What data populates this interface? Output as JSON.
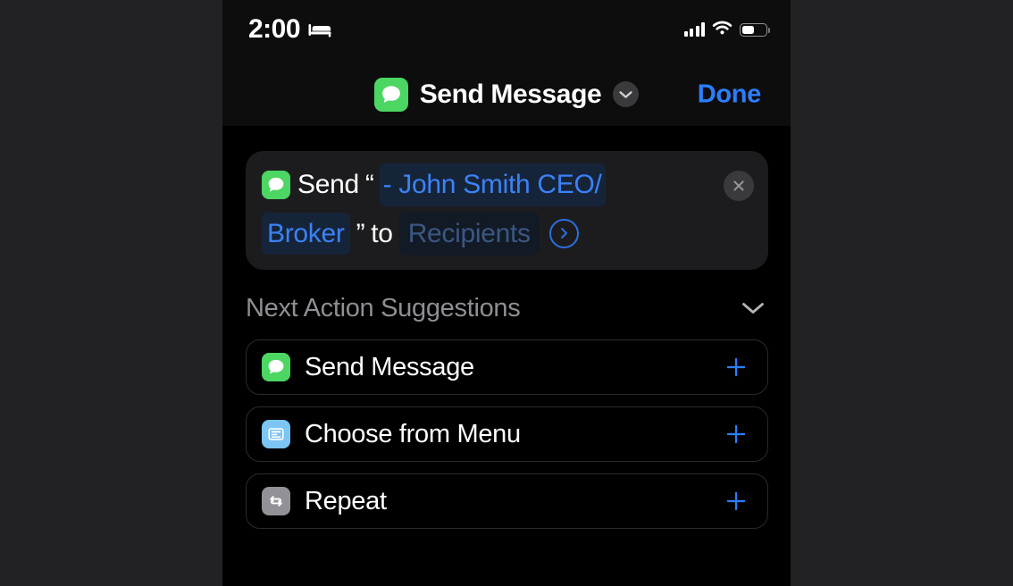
{
  "status_bar": {
    "time": "2:00",
    "focus_icon": "bed-icon",
    "cellular_icon": "cellular-bars-icon",
    "wifi_icon": "wifi-icon",
    "battery_icon": "battery-icon",
    "battery_level_percent": 50
  },
  "nav_bar": {
    "app_icon": "messages-app-icon",
    "title": "Send Message",
    "chevron_icon": "chevron-down-icon",
    "done_label": "Done"
  },
  "action_card": {
    "app_icon": "messages-app-icon",
    "verb": "Send",
    "open_quote": "“",
    "variable_line1": "- John Smith CEO/",
    "variable_line2": "Broker",
    "close_quote": "”",
    "preposition": "to",
    "recipients_placeholder": "Recipients",
    "clear_icon": "close-x-icon",
    "disclosure_icon": "chevron-right-circle-icon"
  },
  "suggestions": {
    "title": "Next Action Suggestions",
    "toggle_icon": "chevron-down-icon",
    "items": [
      {
        "label": "Send Message",
        "icon": "messages-app-icon",
        "icon_style": "messages",
        "add_icon": "plus-icon"
      },
      {
        "label": "Choose from Menu",
        "icon": "menu-card-icon",
        "icon_style": "menu",
        "add_icon": "plus-icon"
      },
      {
        "label": "Repeat",
        "icon": "repeat-arrows-icon",
        "icon_style": "repeat",
        "add_icon": "plus-icon"
      }
    ]
  },
  "colors": {
    "accent_blue": "#2b7fff",
    "messages_green": "#4cd662",
    "variable_blue": "#3b82f6",
    "placeholder_blue": "#3b5782",
    "secondary_text": "#8e8e93",
    "card_background": "#1c1c1e",
    "screen_background": "#000000",
    "letterbox": "#222224"
  }
}
